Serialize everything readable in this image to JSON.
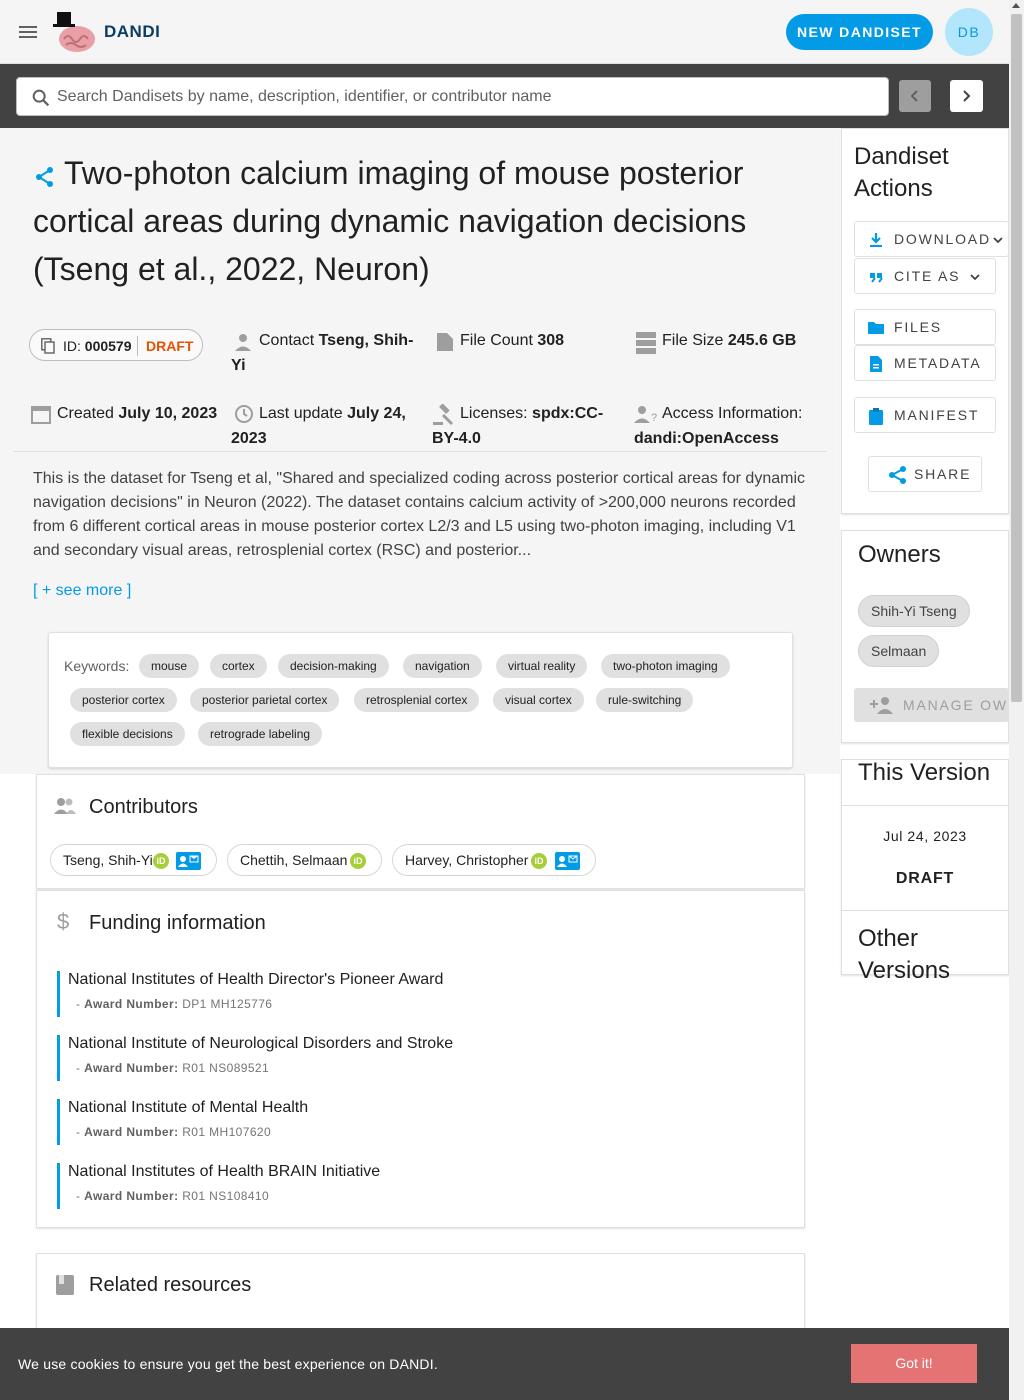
{
  "app": {
    "brand": "DANDI",
    "new_button": "NEW DANDISET",
    "user_initials": "DB"
  },
  "search": {
    "placeholder": "Search Dandisets by name, description, identifier, or contributor name"
  },
  "dandiset": {
    "title": "Two-photon calcium imaging of mouse posterior cortical areas during dynamic navigation decisions (Tseng et al., 2022, Neuron)",
    "id_label": "ID:",
    "id_value": "000579",
    "status": "DRAFT",
    "contact_label": "Contact",
    "contact_value": "Tseng, Shih-Yi",
    "file_count_label": "File Count",
    "file_count_value": "308",
    "file_size_label": "File Size",
    "file_size_value": "245.6 GB",
    "created_label": "Created",
    "created_value": "July 10, 2023",
    "updated_label": "Last update",
    "updated_value": "July 24, 2023",
    "license_label": "Licenses:",
    "license_value": "spdx:CC-BY-4.0",
    "access_label": "Access Information:",
    "access_value": "dandi:OpenAccess",
    "description": "This is the dataset for Tseng et al, \"Shared and specialized coding across posterior cortical areas for dynamic navigation decisions\" in Neuron (2022). The dataset contains calcium activity of >200,000 neurons recorded from 6 different cortical areas in mouse posterior cortex L2/3 and L5 using two-photon imaging, including V1 and secondary visual areas, retrosplenial cortex (RSC) and posterior...",
    "see_more": "[ + see more ]",
    "keywords_label": "Keywords:",
    "keywords": [
      "mouse",
      "cortex",
      "decision-making",
      "navigation",
      "virtual reality",
      "two-photon imaging",
      "posterior cortex",
      "posterior parietal cortex",
      "retrosplenial cortex",
      "visual cortex",
      "rule-switching",
      "flexible decisions",
      "retrograde labeling"
    ]
  },
  "contributors": {
    "title": "Contributors",
    "people": [
      {
        "name": "Tseng, Shih-Yi",
        "orcid": "iD"
      },
      {
        "name": "Chettih, Selmaan",
        "orcid": "iD"
      },
      {
        "name": "Harvey, Christopher",
        "orcid": "iD"
      }
    ]
  },
  "funding": {
    "title": "Funding information",
    "award_label": "Award Number:",
    "items": [
      {
        "name": "National Institutes of Health Director's Pioneer Award",
        "award": "DP1 MH125776"
      },
      {
        "name": "National Institute of Neurological Disorders and Stroke",
        "award": "R01 NS089521"
      },
      {
        "name": "National Institute of Mental Health",
        "award": "R01 MH107620"
      },
      {
        "name": "National Institutes of Health BRAIN Initiative",
        "award": "R01 NS108410"
      }
    ]
  },
  "related": {
    "title": "Related resources"
  },
  "actions": {
    "title": "Dandiset Actions",
    "download": "DOWNLOAD",
    "cite": "CITE AS",
    "files": "FILES",
    "metadata": "METADATA",
    "manifest": "MANIFEST",
    "share": "SHARE"
  },
  "owners": {
    "title": "Owners",
    "names": [
      "Shih-Yi Tseng",
      "Selmaan"
    ],
    "manage": "MANAGE OWNERS"
  },
  "version": {
    "title": "This Version",
    "date": "Jul 24, 2023",
    "label": "DRAFT",
    "other_title": "Other Versions"
  },
  "cookie": {
    "text": "We use cookies to ensure you get the best experience on DANDI.",
    "button": "Got it!"
  },
  "colors": {
    "accent": "#039be5",
    "draft": "#e65100",
    "orcid": "#a6ce39",
    "cookie_button": "#e57373"
  }
}
